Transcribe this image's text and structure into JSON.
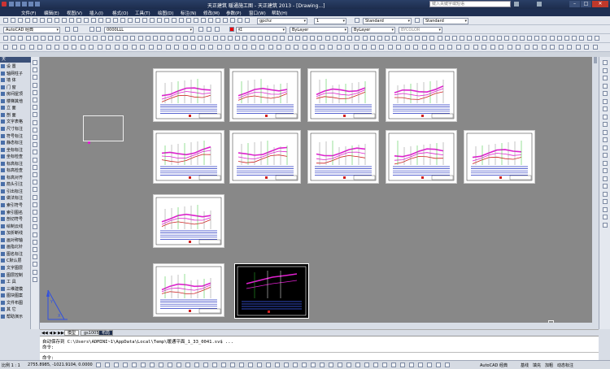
{
  "title": {
    "app_name": "天正建筑",
    "doc_name": "暖通施工图",
    "suffix": "- 天正建筑 2013 - [Drawing...]",
    "search_placeholder": "键入关键字或短语"
  },
  "menu": [
    "文件(F)",
    "编辑(E)",
    "视图(V)",
    "插入(I)",
    "格式(O)",
    "工具(T)",
    "绘图(D)",
    "标注(N)",
    "修改(M)",
    "参数(P)",
    "窗口(W)",
    "帮助(H)"
  ],
  "toolbar": {
    "workspace": "AutoCAD 经典",
    "layer": "0000LLL",
    "color": "红",
    "linetype": "ByLayer",
    "lineweight": "ByLayer",
    "plotstyle": "BYCOLOR",
    "dimstyle": "gpchz",
    "scale": "1",
    "textstyle": "Standard",
    "tablestyle": "Standard"
  },
  "left_palette": {
    "header": "天",
    "items": [
      "设 置",
      "轴网柱子",
      "墙 体",
      "门 窗",
      "房间屋顶",
      "楼梯其他",
      "立 面",
      "剖 面",
      "文字表格",
      "尺寸标注",
      "符号标注",
      "静态标注",
      "坐标标注",
      "坐标检查",
      "标高标注",
      "标高检查",
      "标高对齐",
      "箭头引注",
      "引出标注",
      "做法标注",
      "索引符号",
      "索引图名",
      "剖切符号",
      "绘制云线",
      "加折断线",
      "画对称轴",
      "画指北针",
      "图名标注",
      "C默认层",
      "文字图层",
      "图层控制",
      "工 具",
      "三维建模",
      "图块图案",
      "文件布图",
      "其 它",
      "帮助演示"
    ]
  },
  "tabs": [
    "模型",
    "gs1005",
    "布局"
  ],
  "command": {
    "line1": "自动保存到 C:\\Users\\ADMINI~1\\AppData\\Local\\Temp\\暖通平面_1_33_0041.sv$ ...",
    "prompt1": "命令:",
    "prompt2": "命令:"
  },
  "status": {
    "scale": "比例 1 : 1",
    "coords": "2755.8985, -1021.9104, 0.0000",
    "workspace": "AutoCAD 经典",
    "right_items": [
      "基线",
      "填充",
      "加粗",
      "动态标注"
    ]
  },
  "colors": {
    "canvas_bg": "#888888",
    "sheet_bg": "#ffffff",
    "titlebar": "#1d2d4d",
    "magenta_line": "#e020d0",
    "blue_table": "#2030c0",
    "green": "#30c030"
  }
}
